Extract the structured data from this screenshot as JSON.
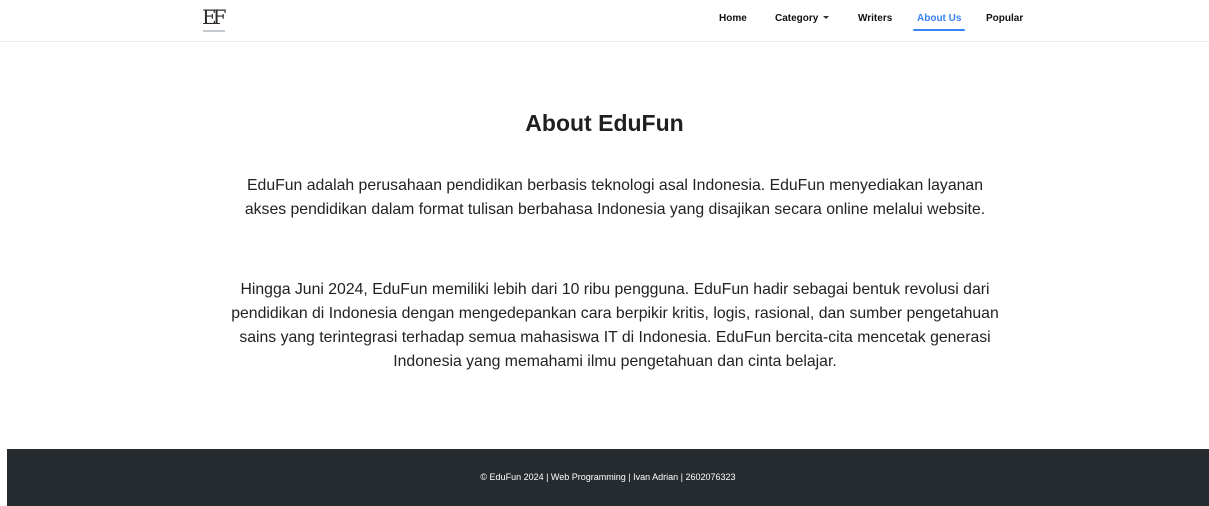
{
  "brand": {
    "logo_text": "EF"
  },
  "nav": {
    "items": [
      {
        "label": "Home"
      },
      {
        "label": "Category"
      },
      {
        "label": "Writers"
      },
      {
        "label": "About Us"
      },
      {
        "label": "Popular"
      }
    ],
    "active": "About Us"
  },
  "main": {
    "title": "About EduFun",
    "paragraphs": [
      "EduFun adalah perusahaan pendidikan berbasis teknologi asal Indonesia. EduFun menyediakan layanan akses pendidikan dalam format tulisan berbahasa Indonesia yang disajikan secara online melalui website.",
      "Hingga Juni 2024, EduFun memiliki lebih dari 10 ribu pengguna. EduFun hadir sebagai bentuk revolusi dari pendidikan di Indonesia dengan mengedepankan cara berpikir kritis, logis, rasional, dan sumber pengetahuan sains yang terintegrasi terhadap semua mahasiswa IT di Indonesia. EduFun bercita-cita mencetak generasi Indonesia yang memahami ilmu pengetahuan dan cinta belajar."
    ]
  },
  "footer": {
    "text": "© EduFun 2024 | Web Programming | Ivan Adrian | 2602076323"
  },
  "colors": {
    "accent": "#3b82f6",
    "footer_bg": "#262b2f"
  }
}
